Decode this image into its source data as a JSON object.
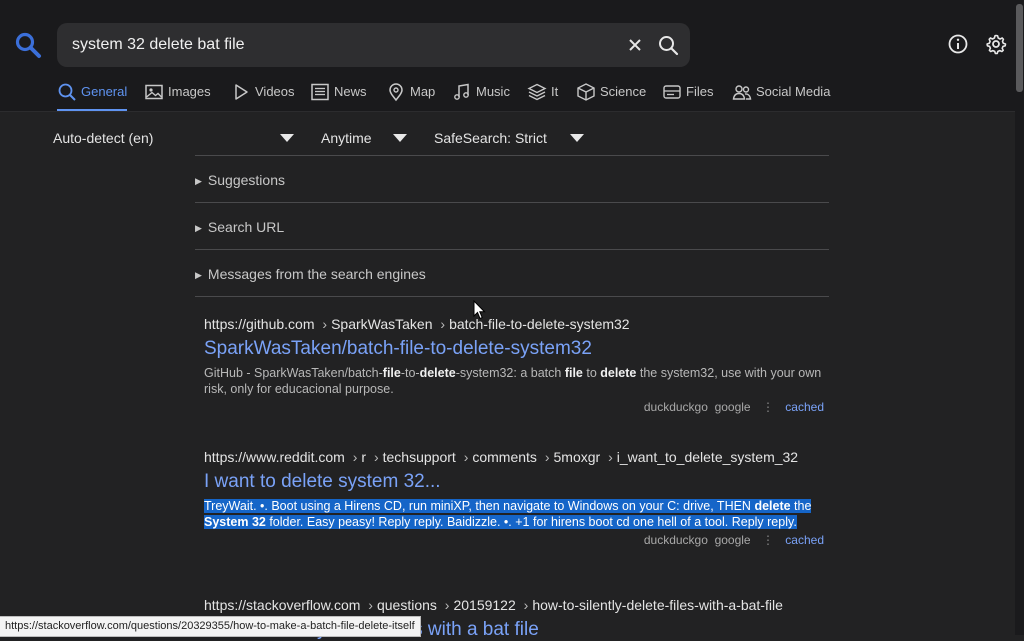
{
  "search": {
    "query": "system 32 delete bat file"
  },
  "tabs": [
    {
      "label": "General",
      "icon": "search-icon",
      "active": true
    },
    {
      "label": "Images",
      "icon": "image-icon"
    },
    {
      "label": "Videos",
      "icon": "play-icon"
    },
    {
      "label": "News",
      "icon": "newspaper-icon"
    },
    {
      "label": "Map",
      "icon": "map-pin-icon"
    },
    {
      "label": "Music",
      "icon": "music-note-icon"
    },
    {
      "label": "It",
      "icon": "layers-icon"
    },
    {
      "label": "Science",
      "icon": "cube-icon"
    },
    {
      "label": "Files",
      "icon": "drive-icon"
    },
    {
      "label": "Social Media",
      "icon": "people-icon"
    }
  ],
  "filters": {
    "language": "Auto-detect (en)",
    "time": "Anytime",
    "safesearch": "SafeSearch: Strict"
  },
  "sections": [
    "Suggestions",
    "Search URL",
    "Messages from the search engines"
  ],
  "results": [
    {
      "url_host": "https://github.com",
      "url_path": [
        "SparkWasTaken",
        "batch-file-to-delete-system32"
      ],
      "title": "SparkWasTaken/batch-file-to-delete-system32",
      "snippet": [
        "GitHub - SparkWasTaken/batch-",
        "file",
        "-to-",
        "delete",
        "-system32: a batch ",
        "file",
        " to ",
        "delete",
        " the system32, use with your own risk, only for educacional purpose."
      ],
      "engines": [
        "duckduckgo",
        "google"
      ],
      "cached": "cached"
    },
    {
      "url_host": "https://www.reddit.com",
      "url_path": [
        "r",
        "techsupport",
        "comments",
        "5moxgr",
        "i_want_to_delete_system_32"
      ],
      "title": "I want to delete system 32...",
      "snippet": [
        "TreyWait. •. Boot using a Hirens CD, run miniXP, then navigate to Windows on your C: drive, THEN ",
        "delete",
        " the ",
        "System 32",
        " folder. Easy peasy! Reply reply. Baidizzle. •. +1 for hirens boot cd one hell of a tool. Reply reply."
      ],
      "engines": [
        "duckduckgo",
        "google"
      ],
      "cached": "cached"
    },
    {
      "url_host": "https://stackoverflow.com",
      "url_path": [
        "questions",
        "20159122",
        "how-to-silently-delete-files-with-a-bat-file"
      ],
      "title": "How to silently delete files with a bat file"
    }
  ],
  "status_url": "https://stackoverflow.com/questions/20329355/how-to-make-a-batch-file-delete-itself",
  "colors": {
    "accent": "#5f93f0",
    "link": "#7aa2f7",
    "selection": "#1565c8",
    "background": "#222223"
  }
}
